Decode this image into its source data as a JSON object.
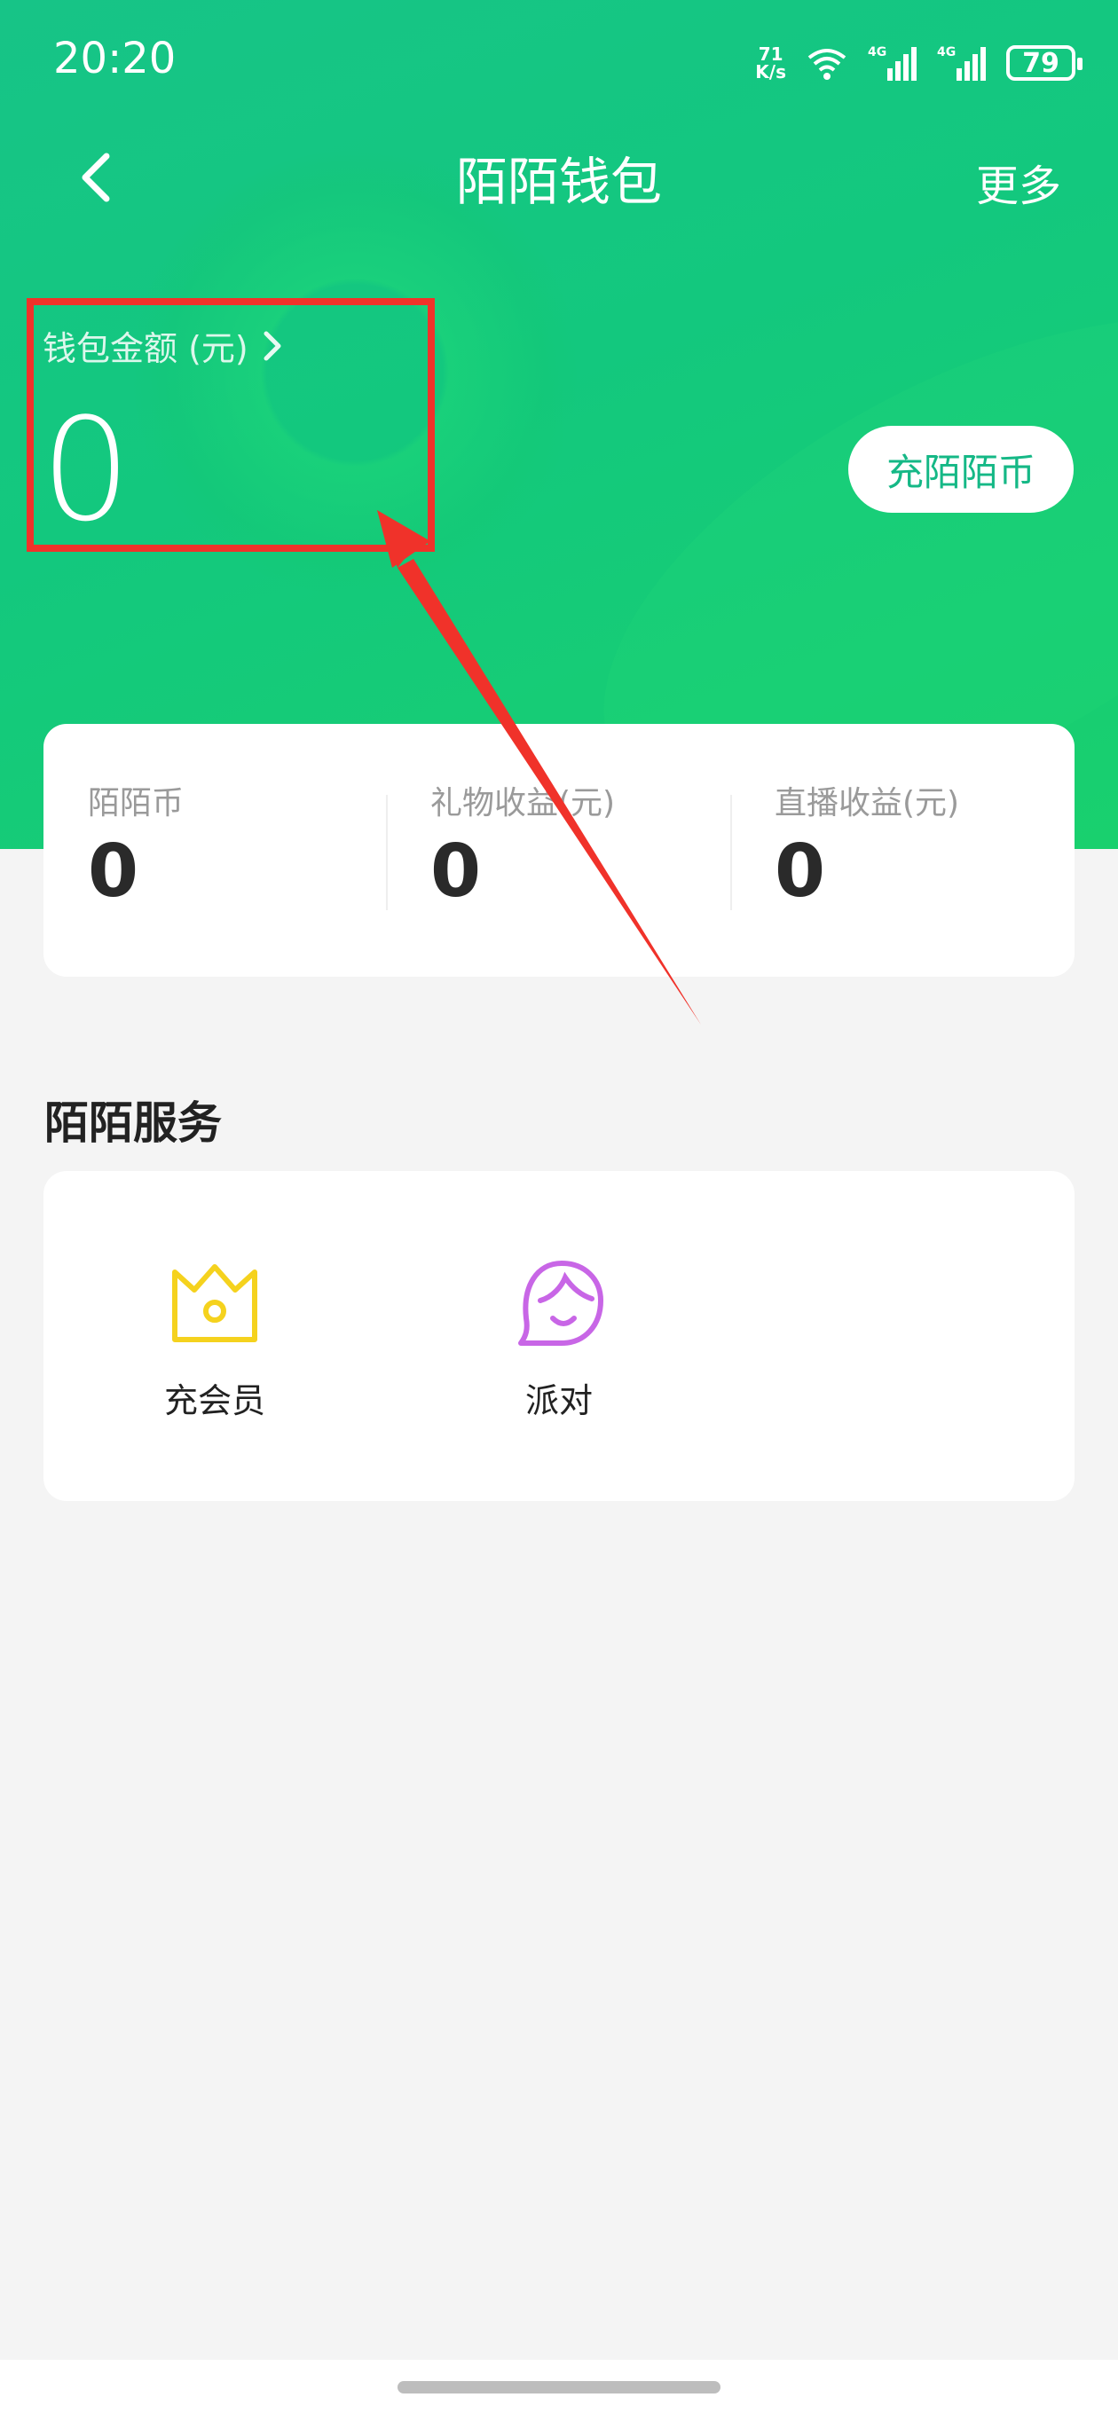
{
  "status_bar": {
    "time": "20:20",
    "net_speed_value": "71",
    "net_speed_unit": "K/s",
    "battery": "79"
  },
  "nav": {
    "title": "陌陌钱包",
    "more": "更多"
  },
  "wallet": {
    "balance_label": "钱包金额 (元)",
    "balance_value": "0",
    "recharge_button": "充陌陌币"
  },
  "stats": [
    {
      "label": "陌陌币",
      "value": "0"
    },
    {
      "label": "礼物收益(元)",
      "value": "0"
    },
    {
      "label": "直播收益(元)",
      "value": "0"
    }
  ],
  "services": {
    "title": "陌陌服务",
    "items": [
      {
        "label": "充会员",
        "icon": "crown-icon",
        "color": "#f5d21e"
      },
      {
        "label": "派对",
        "icon": "face-icon",
        "color": "#c866e6"
      }
    ]
  },
  "colors": {
    "header_green": "#17c487",
    "accent_text": "#15b886",
    "annotation_red": "#f0322a"
  }
}
